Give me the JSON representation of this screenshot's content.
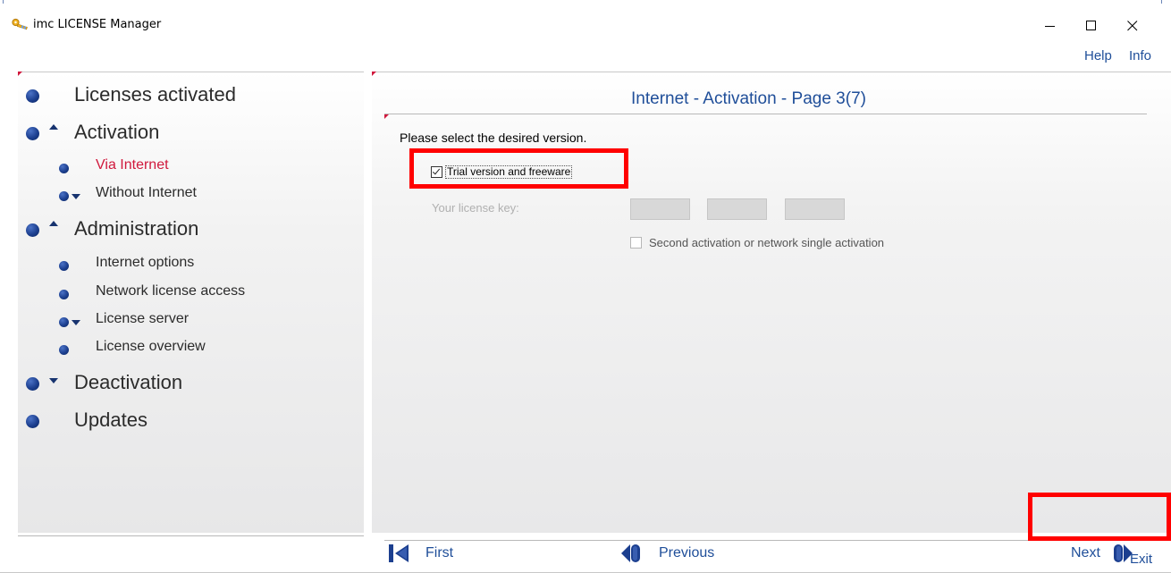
{
  "window": {
    "title": "imc LICENSE Manager",
    "controls": [
      "minimize",
      "maximize",
      "close"
    ]
  },
  "header_links": {
    "help": "Help",
    "info": "Info"
  },
  "sidebar": {
    "items": [
      {
        "label": "Licenses activated",
        "level": 1,
        "arrow": "none"
      },
      {
        "label": "Activation",
        "level": 1,
        "arrow": "up"
      },
      {
        "label": "Via Internet",
        "level": 2,
        "arrow": "none",
        "selected": true
      },
      {
        "label": "Without Internet",
        "level": 2,
        "arrow": "down"
      },
      {
        "label": "Administration",
        "level": 1,
        "arrow": "up"
      },
      {
        "label": "Internet options",
        "level": 2,
        "arrow": "none"
      },
      {
        "label": "Network license access",
        "level": 2,
        "arrow": "none"
      },
      {
        "label": "License server",
        "level": 2,
        "arrow": "down"
      },
      {
        "label": "License overview",
        "level": 2,
        "arrow": "none"
      },
      {
        "label": "Deactivation",
        "level": 1,
        "arrow": "down"
      },
      {
        "label": "Updates",
        "level": 1,
        "arrow": "none"
      }
    ]
  },
  "main": {
    "page_title": "Internet - Activation - Page 3(7)",
    "prompt": "Please select the desired version.",
    "trial_checkbox": {
      "label": "Trial version and freeware",
      "checked": true
    },
    "license_key_label": "Your license key:",
    "license_key_values": [
      "",
      "",
      ""
    ],
    "second_activation": {
      "label": "Second activation or network single activation",
      "checked": false,
      "enabled": false
    }
  },
  "bottom_nav": {
    "first": "First",
    "previous": "Previous",
    "next": "Next"
  },
  "footer": {
    "exit": "Exit"
  },
  "colors": {
    "link_blue": "#1f4e99",
    "selected_red": "#d0183c",
    "highlight_red": "#ff0000",
    "bullet_blue": "#1c3f8f"
  }
}
